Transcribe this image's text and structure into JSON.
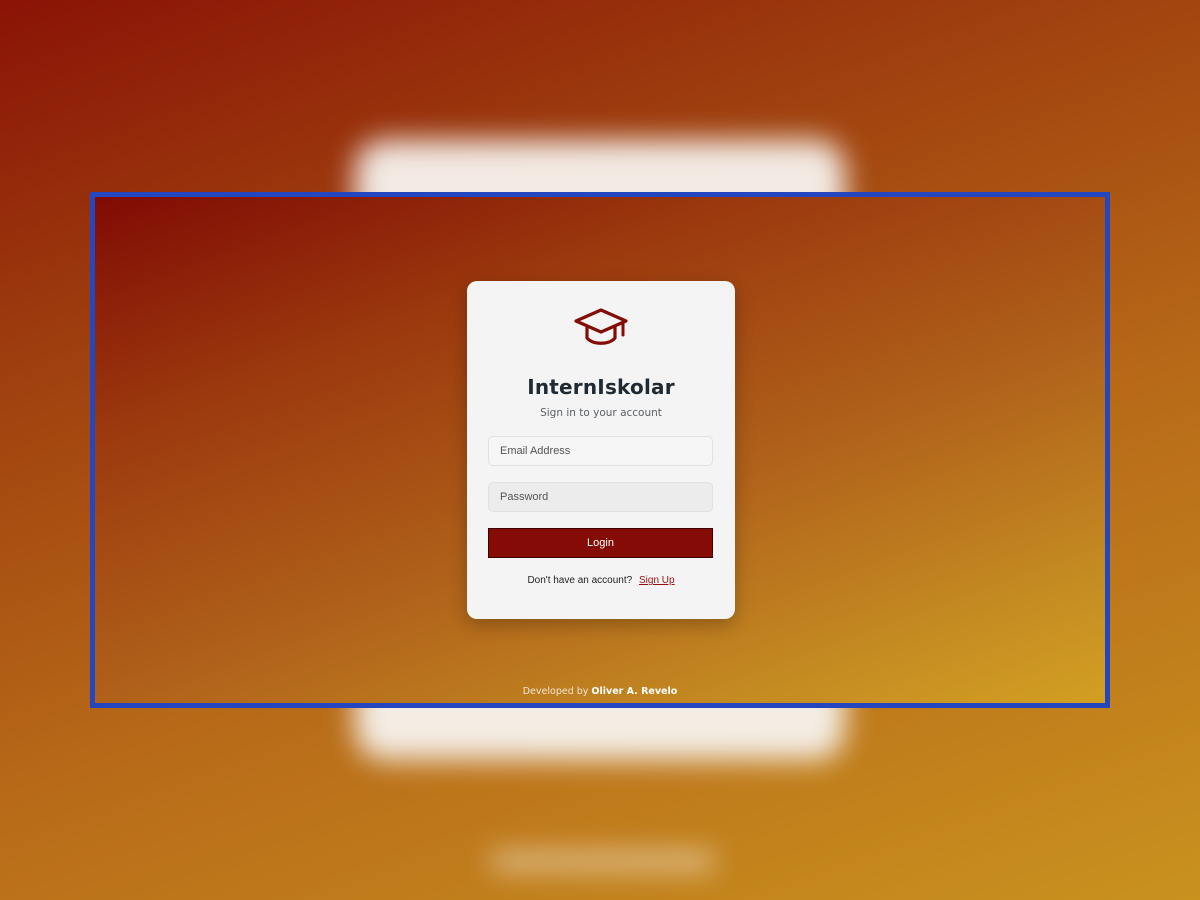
{
  "app": {
    "title": "InternIskolar",
    "subtitle": "Sign in to your account",
    "logo_icon": "graduation-cap-icon",
    "brand_color": "#850c06"
  },
  "form": {
    "email_placeholder": "Email Address",
    "password_placeholder": "Password",
    "login_label": "Login",
    "signup_prompt": "Don't have an account?",
    "signup_label": "Sign Up"
  },
  "footer": {
    "prefix": "Developed by",
    "author": "Oliver A. Revelo"
  }
}
